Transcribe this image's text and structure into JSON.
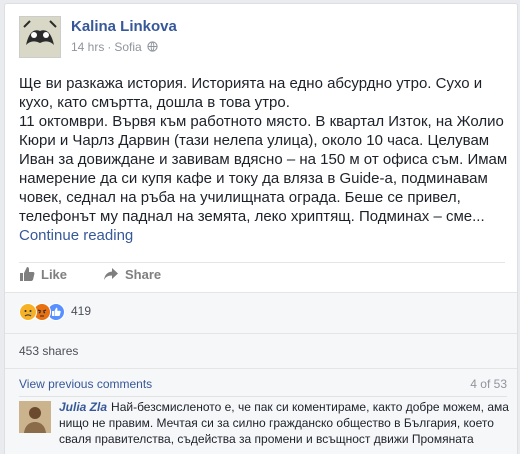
{
  "post": {
    "author": "Kalina Linkova",
    "time": "14 hrs",
    "location": "Sofia",
    "paragraph1": "Ще ви разкажа история. Историята на едно абсурдно утро. Сухо и кухо, като смъртта, дошла в това утро.",
    "paragraph2": "11 октомври. Вървя към работното място. В квартал Изток, на Жолио Кюри и Чарлз Дарвин (тази нелепа улица), около 10 часа. Целувам Иван за довиждане и завивам вдясно – на 150 м от офиса съм. Имам намерение да си купя кафе и току да вляза в Guide-а, подминавам човек, седнал на ръба на училищната ограда. Беше се привел, телефонът му паднал на земята, леко хриптящ. Подминах – сме...",
    "continue_label": "Continue reading"
  },
  "actions": {
    "like_label": "Like",
    "share_label": "Share"
  },
  "reactions": {
    "icons": [
      "sad-icon",
      "angry-icon",
      "like-icon"
    ],
    "count": "419"
  },
  "shares": {
    "text": "453 shares"
  },
  "comments": {
    "view_previous_label": "View previous comments",
    "count": "4 of 53",
    "items": [
      {
        "name": "Julia Zla",
        "text": "Най-безсмисленото е, че пак си коментираме, както добре можем, ама нищо не правим. Мечтая си за силно гражданско общество в България, което сваля правителства, съдейства за промени и всъщност движи Промяната"
      }
    ]
  },
  "colors": {
    "link_blue": "#365899",
    "page_bg": "#e9ebee",
    "like_blue": "#5890ff",
    "angry_red": "#e9710f",
    "sad_yellow": "#f7b125"
  }
}
